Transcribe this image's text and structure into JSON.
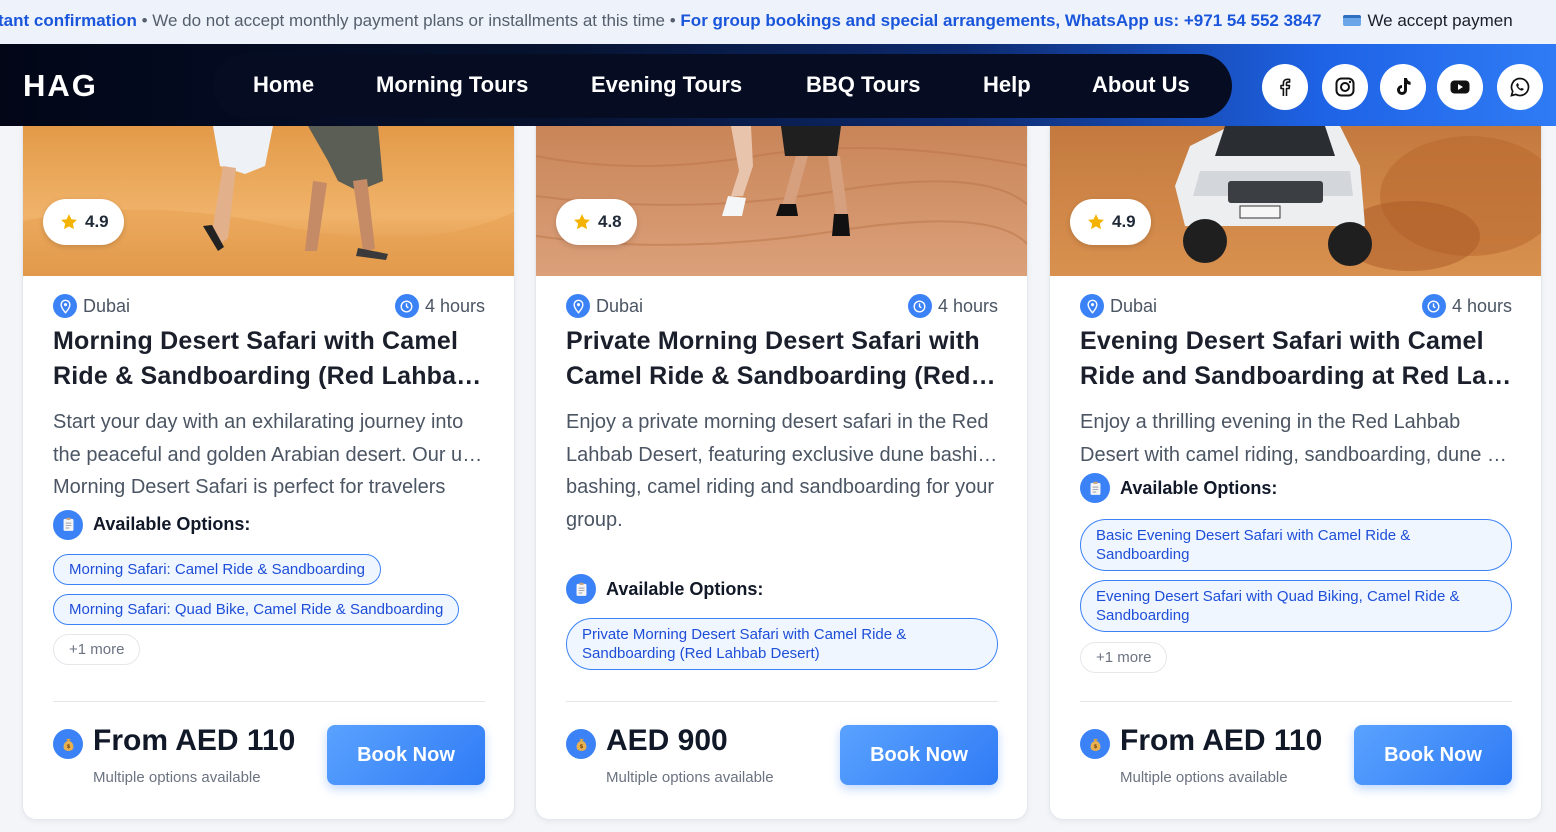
{
  "ticker": {
    "part1": "tant confirmation",
    "sep1": " • ",
    "part2": "We do not accept monthly payment plans or installments at this time",
    "sep2": " • ",
    "part3": "For group bookings and special arrangements, WhatsApp us: +971 54 552 3847",
    "part4": "We accept paymen"
  },
  "header": {
    "logo": "HAG",
    "nav": [
      "Home",
      "Morning Tours",
      "Evening Tours",
      "BBQ Tours",
      "Help",
      "About Us"
    ],
    "social_icons": [
      "facebook-icon",
      "instagram-icon",
      "tiktok-icon",
      "youtube-icon",
      "whatsapp-icon"
    ]
  },
  "cards": [
    {
      "rating": "4.9",
      "location": "Dubai",
      "duration": "4 hours",
      "title_lines": [
        "Morning Desert Safari with Camel",
        "Ride & Sandboarding (Red Lahbab Desert)"
      ],
      "desc_lines": [
        "Start your day with an exhilarating journey into",
        "the peaceful and golden Arabian desert. Our unforgettable",
        "Morning Desert Safari is perfect for travelers"
      ],
      "options_label": "Available Options:",
      "options": [
        "Morning Safari: Camel Ride & Sandboarding",
        "Morning Safari: Quad Bike, Camel Ride & Sandboarding"
      ],
      "more": "+1 more",
      "price": "From AED 110",
      "price_sub": "Multiple options available",
      "book": "Book Now"
    },
    {
      "rating": "4.8",
      "location": "Dubai",
      "duration": "4 hours",
      "title_lines": [
        "Private Morning Desert Safari with",
        "Camel Ride & Sandboarding (Red Lahbab Desert)"
      ],
      "desc_lines": [
        "Enjoy a private morning desert safari in the Red",
        "Lahbab Desert, featuring exclusive dune bashing,",
        "bashing, camel riding and sandboarding for your",
        "group."
      ],
      "options_label": "Available Options:",
      "options": [
        "Private Morning Desert Safari with Camel Ride & Sandboarding (Red Lahbab Desert)"
      ],
      "price": "AED 900",
      "price_sub": "Multiple options available",
      "book": "Book Now"
    },
    {
      "rating": "4.9",
      "location": "Dubai",
      "duration": "4 hours",
      "title_lines": [
        "Evening Desert Safari with Camel",
        "Ride and Sandboarding at Red Lahbab"
      ],
      "desc_lines": [
        "Enjoy a thrilling evening in the Red Lahbab",
        "Desert with camel riding, sandboarding, dune bashing"
      ],
      "options_label": "Available Options:",
      "options": [
        "Basic Evening Desert Safari with Camel Ride & Sandboarding",
        "Evening Desert Safari with Quad Biking, Camel Ride & Sandboarding"
      ],
      "more": "+1 more",
      "price": "From AED 110",
      "price_sub": "Multiple options available",
      "book": "Book Now"
    }
  ],
  "colors": {
    "accent": "#3b82f6",
    "link_blue": "#1a56db",
    "header_dark": "#020617",
    "header_blue": "#2f7bf5"
  }
}
